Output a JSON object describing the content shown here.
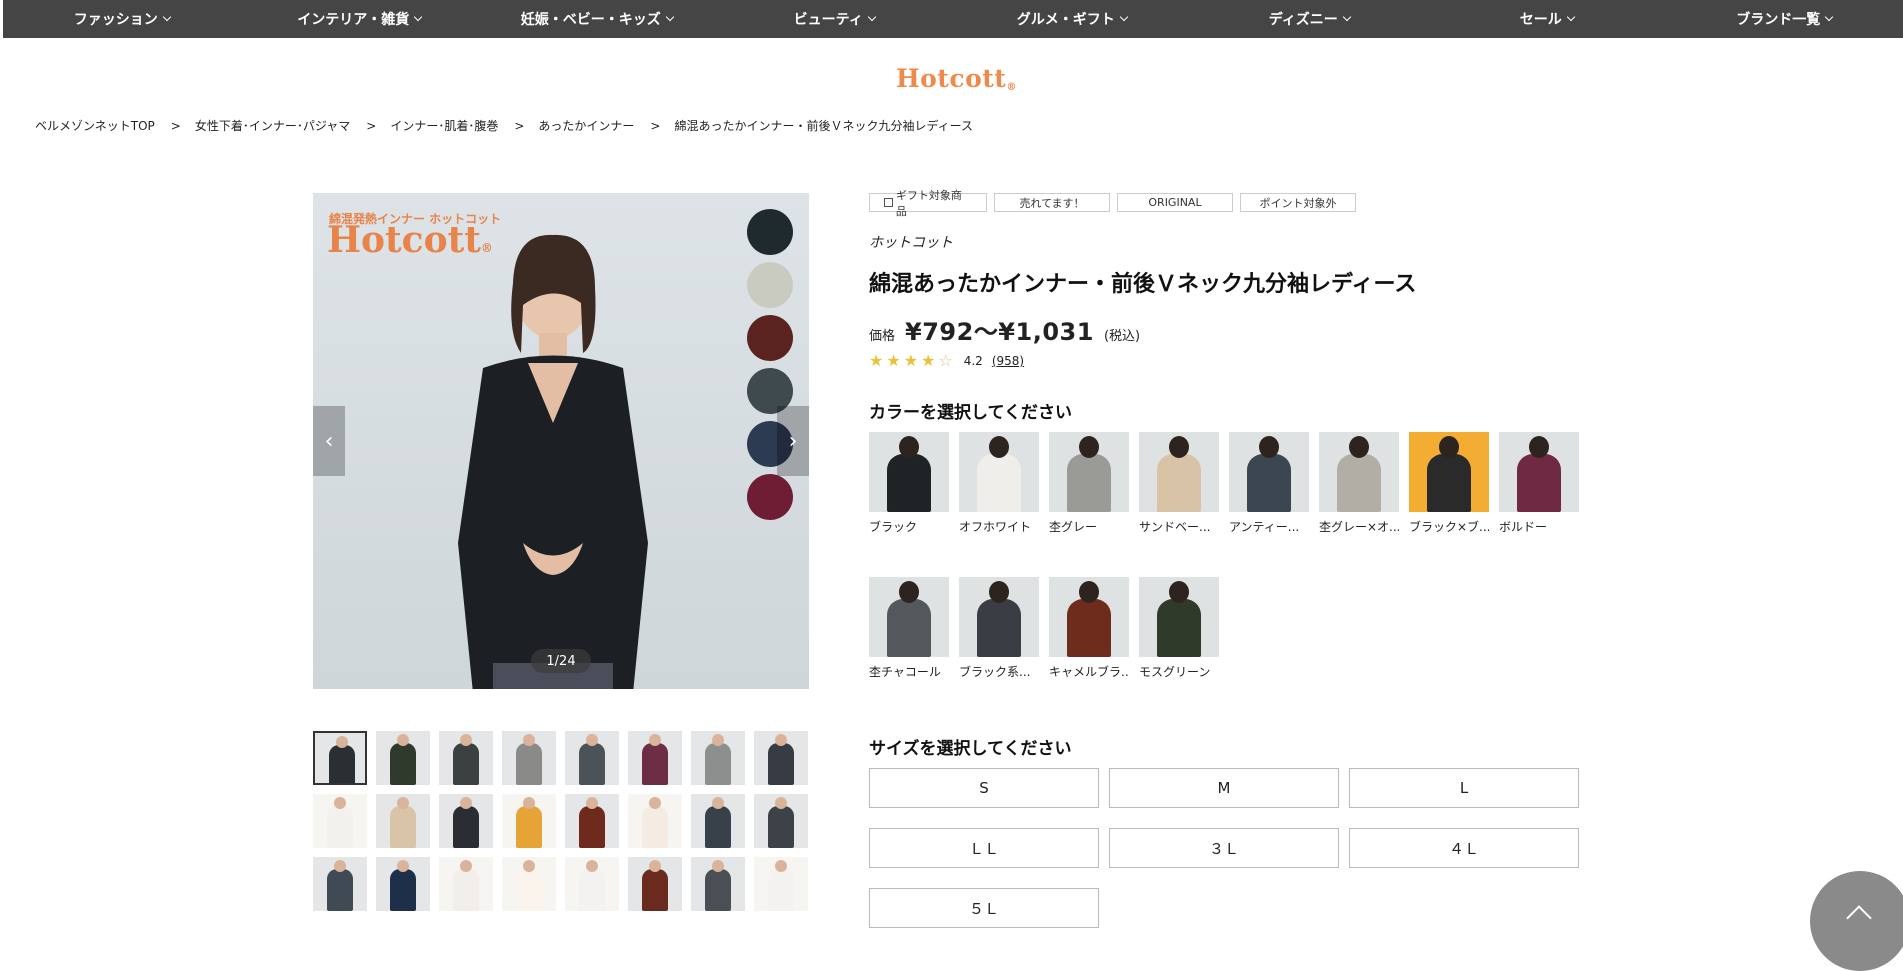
{
  "nav": {
    "items": [
      "ファッション",
      "インテリア・雑貨",
      "妊娠・ベビー・キッズ",
      "ビューティ",
      "グルメ・ギフト",
      "ディズニー",
      "セール",
      "ブランド一覧"
    ]
  },
  "logo": {
    "text": "Hotcott",
    "mark": "®"
  },
  "breadcrumb": [
    "ベルメゾンネットTOP",
    "女性下着･インナー･パジャマ",
    "インナー･肌着･腹巻",
    "あったかインナー",
    "綿混あったかインナー・前後Ｖネック九分袖レディース"
  ],
  "breadcrumb_sep": ">",
  "gallery": {
    "brand_small": "綿混発熱インナー ホットコット",
    "brand_big": "Hotcott",
    "brand_big_mark": "®",
    "counter": "1/24",
    "prev_glyph": "‹",
    "next_glyph": "›",
    "dot_colors": [
      "#1f2a2e",
      "#c9cbc0",
      "#5a2320",
      "#3e4a4d",
      "#2c3a52",
      "#6e1d34"
    ],
    "thumb_colors": [
      "#2a2f33",
      "#2f3a2c",
      "#3b4040",
      "#8a8b88",
      "#4a5358",
      "#6d2e45",
      "#8d8f8e",
      "#363b44",
      "#f2f1ee",
      "#d9c4a8",
      "#2a2d33",
      "#e6a336",
      "#6e2a1d",
      "#f4ece2",
      "#38414a",
      "#3c4248",
      "#404a55",
      "#1e2f4a",
      "#f2efea",
      "#fbf4ed",
      "#f4f2f0",
      "#6a2a1e",
      "#4a4f55",
      "#f3f2f0"
    ]
  },
  "tags": {
    "gift": "ギフト対象商品",
    "selling": "売れてます！",
    "original": "ORIGINAL",
    "point": "ポイント対象外"
  },
  "product": {
    "brand": "ホットコット",
    "title": "綿混あったかインナー・前後Ｖネック九分袖レディース",
    "price_label": "価格",
    "price": "¥792〜¥1,031",
    "tax": "(税込)",
    "rating": "4.2",
    "rating_value": 4.2,
    "reviews": "(958)"
  },
  "colors": {
    "title": "カラーを選択してください",
    "options": [
      {
        "label": "ブラック",
        "color": "#1f2326"
      },
      {
        "label": "オフホワイト",
        "color": "#f0eeea"
      },
      {
        "label": "杢グレー",
        "color": "#9a9a96"
      },
      {
        "label": "サンドベー...",
        "color": "#d8c3a6"
      },
      {
        "label": "アンティー...",
        "color": "#3b4650"
      },
      {
        "label": "杢グレー×オ...",
        "color": "#b2aea6"
      },
      {
        "label": "ブラック×ブ...",
        "color": "#2a2a2a"
      },
      {
        "label": "ボルドー",
        "color": "#6d2a42"
      },
      {
        "label": "杢チャコール",
        "color": "#53585c"
      },
      {
        "label": "ブラック系...",
        "color": "#3a3e44"
      },
      {
        "label": "キャメルブラ...",
        "color": "#6e2d1c"
      },
      {
        "label": "モスグリーン",
        "color": "#2f3a2a"
      }
    ]
  },
  "sizes": {
    "title": "サイズを選択してください",
    "options": [
      "S",
      "M",
      "L",
      "ＬＬ",
      "３Ｌ",
      "４Ｌ",
      "５Ｌ"
    ]
  }
}
